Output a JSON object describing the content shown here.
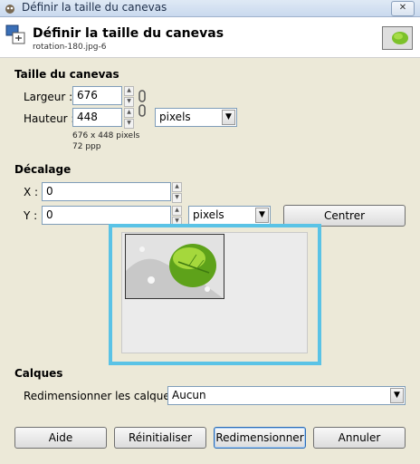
{
  "window": {
    "title": "Définir la taille du canevas",
    "close_label": "✕"
  },
  "header": {
    "title": "Définir la taille du canevas",
    "subtitle": "rotation-180.jpg-6"
  },
  "canvas_size": {
    "section_label": "Taille du canevas",
    "width_label": "Largeur :",
    "width_value": "676",
    "height_label": "Hauteur :",
    "height_value": "448",
    "unit": "pixels",
    "info_size": "676 x 448 pixels",
    "info_res": "72 ppp"
  },
  "offset": {
    "section_label": "Décalage",
    "x_label": "X :",
    "x_value": "0",
    "y_label": "Y :",
    "y_value": "0",
    "unit": "pixels",
    "center_button": "Centrer"
  },
  "layers": {
    "section_label": "Calques",
    "resize_label": "Redimensionner les calques :",
    "resize_value": "Aucun"
  },
  "buttons": {
    "help": "Aide",
    "reset": "Réinitialiser",
    "resize": "Redimensionner",
    "cancel": "Annuler"
  },
  "colors": {
    "highlight_border": "#5ac3e6"
  }
}
